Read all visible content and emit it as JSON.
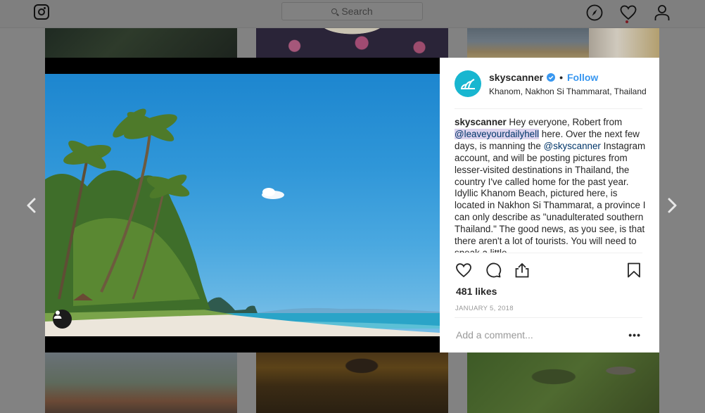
{
  "app": {
    "name": "Instagram"
  },
  "topnav": {
    "search_placeholder": "Search",
    "icons": [
      "instagram-logo-icon",
      "compass-icon",
      "heart-icon",
      "profile-icon"
    ],
    "has_notification": true
  },
  "post": {
    "account": {
      "username": "skyscanner",
      "verified": true,
      "separator": "•",
      "follow_label": "Follow",
      "location": "Khanom, Nakhon Si Thammarat, Thailand",
      "avatar_color": "#18b6d0"
    },
    "caption": {
      "username": "skyscanner",
      "part1": " Hey everyone, Robert from ",
      "mention1": "@leaveyourdailyhell",
      "part2": " here. Over the next few days, is manning the ",
      "mention2": "@skyscanner",
      "part3": " Instagram account, and will be posting pictures from lesser-visited destinations in Thailand, the country I've called home for the past year. Idyllic Khanom Beach, pictured here, is located in Nakhon Si Thammarat, a province I can only describe as \"unadulterated southern Thailand.\" The good news, as you see, is that there aren't a lot of tourists. You will need to speak a little"
    },
    "actions": [
      "like",
      "comment",
      "share",
      "save"
    ],
    "likes": "481 likes",
    "date": "JANUARY 5, 2018",
    "comment_placeholder": "Add a comment...",
    "more_label": "•••"
  },
  "navigation": {
    "prev": "previous-post",
    "next": "next-post"
  },
  "colors": {
    "link": "#3897f0",
    "mention": "#003569",
    "mention_highlight": "#dcd3ee",
    "overlay": "#828282"
  }
}
